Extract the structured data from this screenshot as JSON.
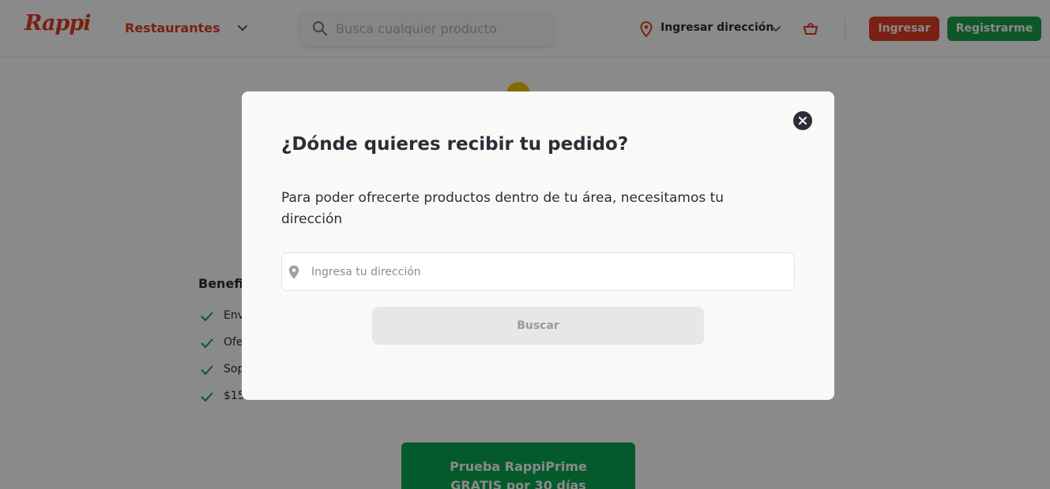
{
  "header": {
    "logo": "Rappi",
    "category": "Restaurantes",
    "search_placeholder": "Busca cualquier producto",
    "address_label": "Ingresar dirección",
    "login_label": "Ingresar",
    "register_label": "Registrarme"
  },
  "background": {
    "benefits_title": "Benefi",
    "benefits": [
      "Env",
      "Ofe",
      "Sop",
      "$15"
    ],
    "prime_cta_line1": "Prueba RappiPrime",
    "prime_cta_line2": "GRATIS por 30 días"
  },
  "modal": {
    "title": "¿Dónde quieres recibir tu pedido?",
    "description": "Para poder ofrecerte productos dentro de tu área, necesitamos tu dirección",
    "address_placeholder": "Ingresa tu dirección",
    "address_value": "",
    "search_button": "Buscar"
  },
  "colors": {
    "brand_red": "#e03d24",
    "brand_green": "#18a24b",
    "text_dark": "#2e2c36",
    "overlay": "rgba(0,0,0,0.46)"
  },
  "icons": {
    "close": "close-icon",
    "address": "location-pin-icon",
    "search": "search-icon",
    "cart": "cart-icon"
  }
}
